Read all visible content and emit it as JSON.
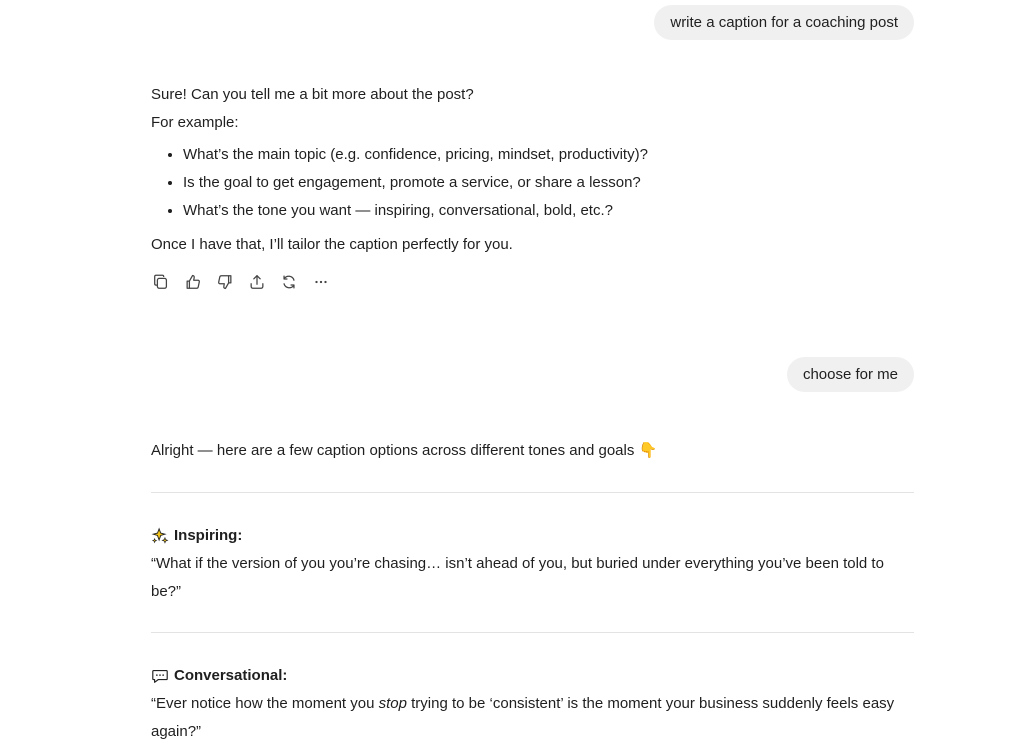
{
  "conversation": {
    "user_message_1": "write a caption for a coaching post",
    "assistant_reply_1": {
      "intro": "Sure! Can you tell me a bit more about the post?",
      "for_example": "For example:",
      "bullets": [
        "What’s the main topic (e.g. confidence, pricing, mindset, productivity)?",
        "Is the goal to get engagement, promote a service, or share a lesson?",
        "What’s the tone you want — inspiring, conversational, bold, etc.?"
      ],
      "closing": "Once I have that, I’ll tailor the caption perfectly for you."
    },
    "actions": [
      "copy-icon",
      "thumbs-up-icon",
      "thumbs-down-icon",
      "share-icon",
      "regenerate-icon",
      "more-icon"
    ],
    "user_message_2": "choose for me",
    "assistant_reply_2": {
      "intro": "Alright — here are a few caption options across different tones and goals 👇",
      "options": [
        {
          "icon": "sparkles-icon",
          "heading": "Inspiring:",
          "quote": "“What if the version of you you’re chasing… isn’t ahead of you, but buried under everything you’ve been told to be?”"
        },
        {
          "icon": "speech-bubble-icon",
          "heading": "Conversational:",
          "quote_before": "“Ever notice how the moment you ",
          "quote_emphasis": "stop",
          "quote_after": " trying to be ‘consistent’ is the moment your business suddenly feels easy again?”"
        }
      ]
    }
  }
}
